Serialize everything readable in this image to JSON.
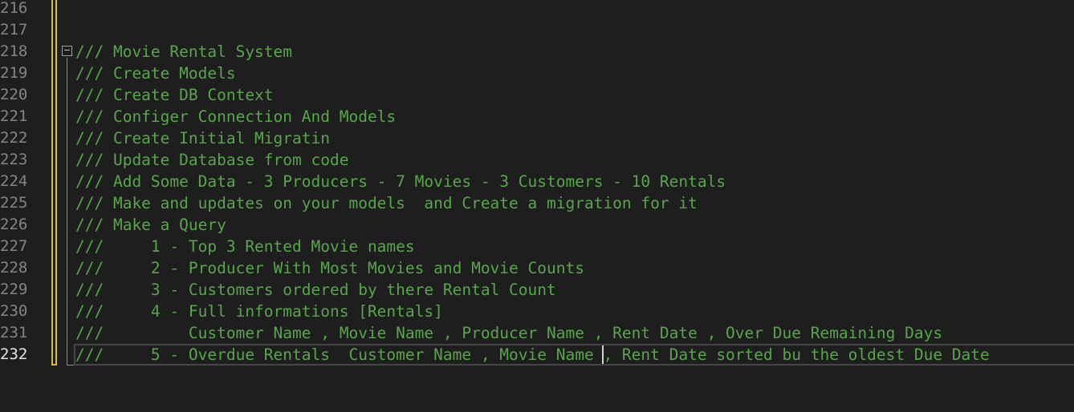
{
  "editor": {
    "line_numbers": [
      "216",
      "217",
      "218",
      "219",
      "220",
      "221",
      "222",
      "223",
      "224",
      "225",
      "226",
      "227",
      "228",
      "229",
      "230",
      "231",
      "232"
    ],
    "current_line": "232",
    "fold_icon_glyph": "−",
    "lines": [
      "",
      "",
      "/// Movie Rental System",
      "/// Create Models",
      "/// Create DB Context",
      "/// Configer Connection And Models",
      "/// Create Initial Migratin",
      "/// Update Database from code",
      "/// Add Some Data - 3 Producers - 7 Movies - 3 Customers - 10 Rentals",
      "/// Make and updates on your models  and Create a migration for it",
      "/// Make a Query",
      "///     1 - Top 3 Rented Movie names",
      "///     2 - Producer With Most Movies and Movie Counts",
      "///     3 - Customers ordered by there Rental Count",
      "///     4 - Full informations [Rentals]",
      "///         Customer Name , Movie Name , Producer Name , Rent Date , Over Due Remaining Days",
      "///     5 - Overdue Rentals  Customer Name , Movie Name , Rent Date sorted bu the oldest Due Date"
    ]
  },
  "colors": {
    "background": "#1e1e1e",
    "comment": "#57a64a",
    "line_number": "#858585",
    "change_bar": "#d7ba36"
  }
}
